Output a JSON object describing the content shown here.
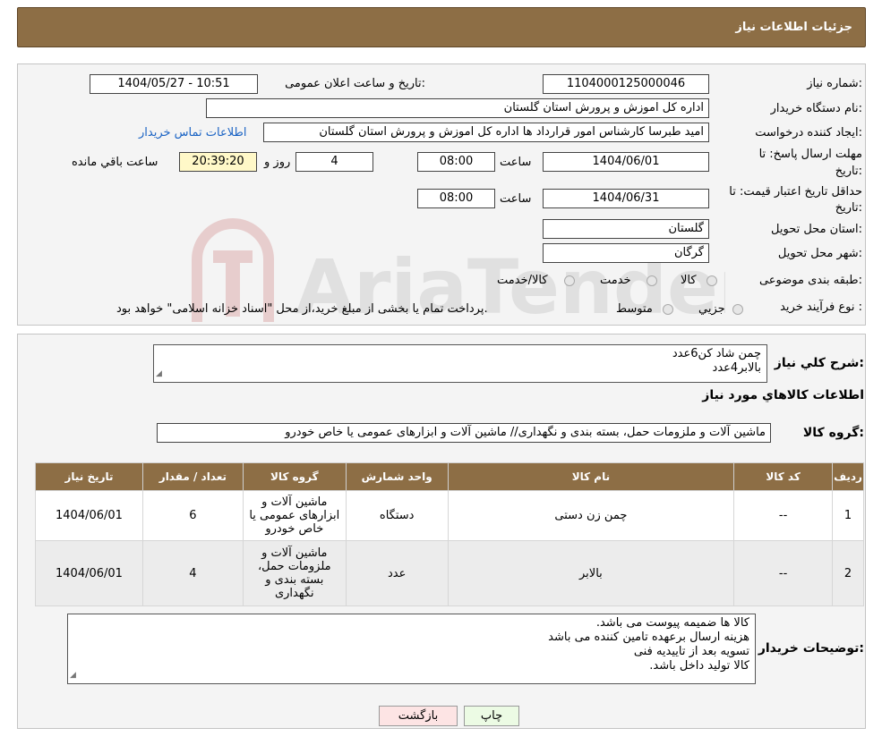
{
  "header": {
    "title": "جزئیات اطلاعات نیاز"
  },
  "form": {
    "need_number_label": "شماره نیاز:",
    "need_number": "1104000125000046",
    "announce_label": "تاریخ و ساعت اعلان عمومی:",
    "announce_value": "1404/05/27 - 10:51",
    "buyer_org_label": "نام دستگاه خریدار:",
    "buyer_org": "اداره کل اموزش و پرورش استان گلستان",
    "creator_label": "ایجاد کننده درخواست:",
    "creator": "امید طبرسا کارشناس امور قرارداد ها اداره کل اموزش و پرورش استان گلستان",
    "contact_link": "اطلاعات تماس خریدار",
    "deadline_label_1": "مهلت ارسال پاسخ: تا",
    "deadline_label_2": "تاریخ:",
    "deadline_date": "1404/06/01",
    "time_label": "ساعت",
    "deadline_time": "08:00",
    "days_value": "4",
    "days_label": "روز و",
    "remaining_time": "20:39:20",
    "remaining_label": "ساعت باقي مانده",
    "validity_label_1": "حداقل تاریخ اعتبار قیمت: تا",
    "validity_label_2": "تاریخ:",
    "validity_date": "1404/06/31",
    "validity_time": "08:00",
    "province_label": "استان محل تحویل:",
    "province": "گلستان",
    "city_label": "شهر محل تحویل:",
    "city": "گرگان",
    "category_label": "طبقه بندی موضوعی:",
    "category_options": [
      "کالا",
      "خدمت",
      "کالا/خدمت"
    ],
    "process_label": "نوع فرآیند خرید :",
    "process_options": [
      "جزیي",
      "متوسط"
    ],
    "process_note": "پرداخت تمام یا بخشی از مبلغ خرید،از محل \"اسناد خزانه اسلامی\" خواهد بود."
  },
  "summary": {
    "label": "شرح کلي نياز:",
    "lines": [
      "چمن شاد کن6عدد",
      "بالابر4عدد"
    ]
  },
  "goods": {
    "section_title": "اطلاعات کالاهاي مورد نياز",
    "group_label": "گروه کالا:",
    "group_value": "ماشین آلات و ملزومات حمل، بسته بندی و نگهداری//  ماشین آلات و ابزارهای عمومی یا خاص خودرو"
  },
  "table": {
    "headers": [
      "ردیف",
      "کد کالا",
      "نام کالا",
      "واحد شمارش",
      "گروه کالا",
      "تعداد / مقدار",
      "تاریخ نیاز"
    ],
    "rows": [
      [
        "1",
        "--",
        "چمن زن دستی",
        "دستگاه",
        "ماشین آلات و ابزارهای عمومی یا خاص خودرو",
        "6",
        "1404/06/01"
      ],
      [
        "2",
        "--",
        "بالابر",
        "عدد",
        "ماشین آلات و ملزومات حمل، بسته بندی و نگهداری",
        "4",
        "1404/06/01"
      ]
    ]
  },
  "buyer_notes": {
    "label": "توضیحات خریدار:",
    "lines": [
      "کالا ها ضمیمه پیوست می باشد.",
      "هزینه ارسال برعهده تامین کننده می باشد",
      "تسویه بعد از تاییدیه فنی",
      "کالا تولید داخل باشد."
    ]
  },
  "buttons": {
    "print": "چاپ",
    "back": "بازگشت"
  },
  "watermark": {
    "text": "AriaTender.neT"
  },
  "colors": {
    "header_bg": "#8d6e45",
    "link": "#1a63c4",
    "highlight": "#fff8c8",
    "back_btn": "#fde4e4",
    "print_btn": "#ecfbe4"
  }
}
